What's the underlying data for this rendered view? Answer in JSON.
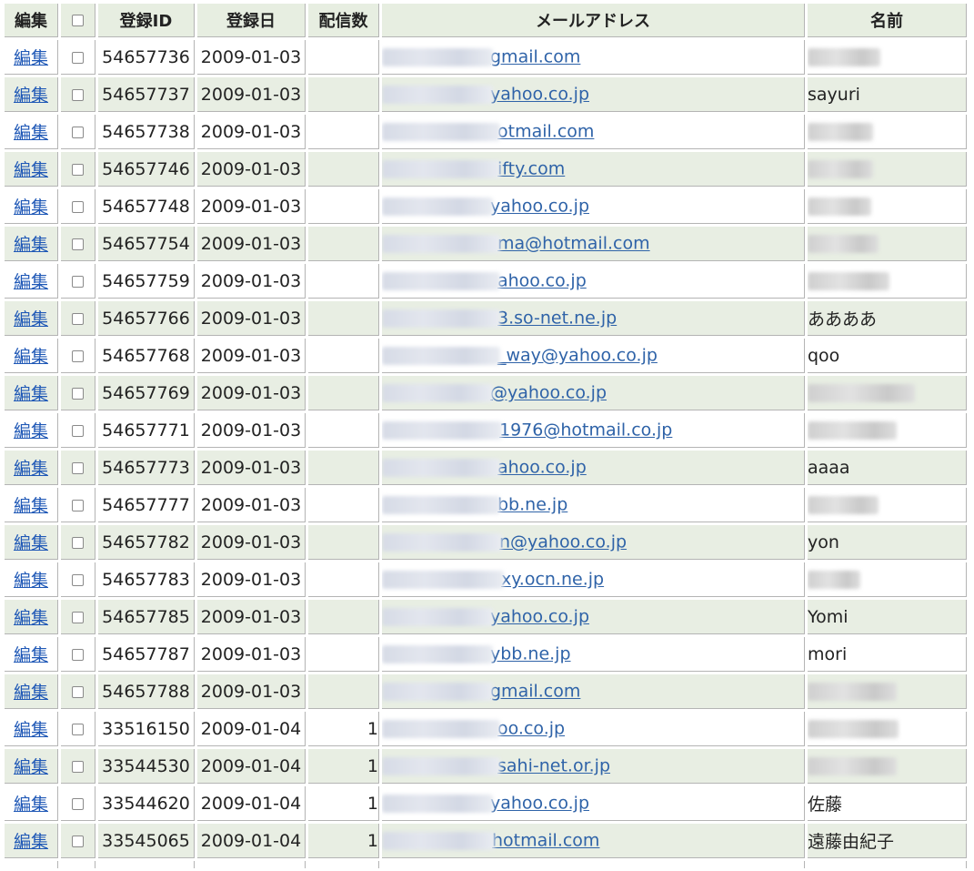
{
  "headers": {
    "edit": "編集",
    "checkbox": "",
    "id": "登録ID",
    "date": "登録日",
    "count": "配信数",
    "email": "メールアドレス",
    "name": "名前"
  },
  "edit_label": "編集",
  "rows": [
    {
      "id": "54657736",
      "date": "2009-01-03",
      "count": "",
      "email_visible": "gmail.com",
      "email_blur_w": 122,
      "name": "",
      "name_blur_w": 80
    },
    {
      "id": "54657737",
      "date": "2009-01-03",
      "count": "",
      "email_visible": "yahoo.co.jp",
      "email_blur_w": 122,
      "name": "sayuri",
      "name_blur_w": 0
    },
    {
      "id": "54657738",
      "date": "2009-01-03",
      "count": "",
      "email_visible": "otmail.com",
      "email_blur_w": 130,
      "name": "",
      "name_blur_w": 72
    },
    {
      "id": "54657746",
      "date": "2009-01-03",
      "count": "",
      "email_visible": "ifty.com",
      "email_blur_w": 130,
      "name": "",
      "name_blur_w": 72
    },
    {
      "id": "54657748",
      "date": "2009-01-03",
      "count": "",
      "email_visible": "yahoo.co.jp",
      "email_blur_w": 122,
      "name": "",
      "name_blur_w": 70
    },
    {
      "id": "54657754",
      "date": "2009-01-03",
      "count": "",
      "email_visible": "ma@hotmail.com",
      "email_blur_w": 130,
      "name": "",
      "name_blur_w": 78
    },
    {
      "id": "54657759",
      "date": "2009-01-03",
      "count": "",
      "email_visible": "ahoo.co.jp",
      "email_blur_w": 130,
      "name": "",
      "name_blur_w": 90
    },
    {
      "id": "54657766",
      "date": "2009-01-03",
      "count": "",
      "email_visible": "3.so-net.ne.jp",
      "email_blur_w": 130,
      "name": "ああああ",
      "name_blur_w": 0
    },
    {
      "id": "54657768",
      "date": "2009-01-03",
      "count": "",
      "email_visible": "_way@yahoo.co.jp",
      "email_blur_w": 130,
      "name": "qoo",
      "name_blur_w": 0
    },
    {
      "id": "54657769",
      "date": "2009-01-03",
      "count": "",
      "email_visible": "@yahoo.co.jp",
      "email_blur_w": 122,
      "name": "",
      "name_blur_w": 118
    },
    {
      "id": "54657771",
      "date": "2009-01-03",
      "count": "",
      "email_visible": "1976@hotmail.co.jp",
      "email_blur_w": 132,
      "name": "",
      "name_blur_w": 98
    },
    {
      "id": "54657773",
      "date": "2009-01-03",
      "count": "",
      "email_visible": "ahoo.co.jp",
      "email_blur_w": 130,
      "name": "aaaa",
      "name_blur_w": 0
    },
    {
      "id": "54657777",
      "date": "2009-01-03",
      "count": "",
      "email_visible": "bb.ne.jp",
      "email_blur_w": 130,
      "name": "",
      "name_blur_w": 78
    },
    {
      "id": "54657782",
      "date": "2009-01-03",
      "count": "",
      "email_visible": "n@yahoo.co.jp",
      "email_blur_w": 132,
      "name": "yon",
      "name_blur_w": 0
    },
    {
      "id": "54657783",
      "date": "2009-01-03",
      "count": "",
      "email_visible": "xy.ocn.ne.jp",
      "email_blur_w": 134,
      "name": "",
      "name_blur_w": 58
    },
    {
      "id": "54657785",
      "date": "2009-01-03",
      "count": "",
      "email_visible": "yahoo.co.jp",
      "email_blur_w": 122,
      "name": "Yomi",
      "name_blur_w": 0
    },
    {
      "id": "54657787",
      "date": "2009-01-03",
      "count": "",
      "email_visible": "ybb.ne.jp",
      "email_blur_w": 122,
      "name": "mori",
      "name_blur_w": 0
    },
    {
      "id": "54657788",
      "date": "2009-01-03",
      "count": "",
      "email_visible": "gmail.com",
      "email_blur_w": 122,
      "name": "",
      "name_blur_w": 98
    },
    {
      "id": "33516150",
      "date": "2009-01-04",
      "count": "1",
      "email_visible": "oo.co.jp",
      "email_blur_w": 130,
      "name": "",
      "name_blur_w": 100
    },
    {
      "id": "33544530",
      "date": "2009-01-04",
      "count": "1",
      "email_visible": "sahi-net.or.jp",
      "email_blur_w": 130,
      "name": "",
      "name_blur_w": 98
    },
    {
      "id": "33544620",
      "date": "2009-01-04",
      "count": "1",
      "email_visible": "yahoo.co.jp",
      "email_blur_w": 122,
      "name": "佐藤",
      "name_blur_w": 0
    },
    {
      "id": "33545065",
      "date": "2009-01-04",
      "count": "1",
      "email_visible": "hotmail.com",
      "email_blur_w": 124,
      "name": "遠藤由紀子",
      "name_blur_w": 0
    }
  ]
}
